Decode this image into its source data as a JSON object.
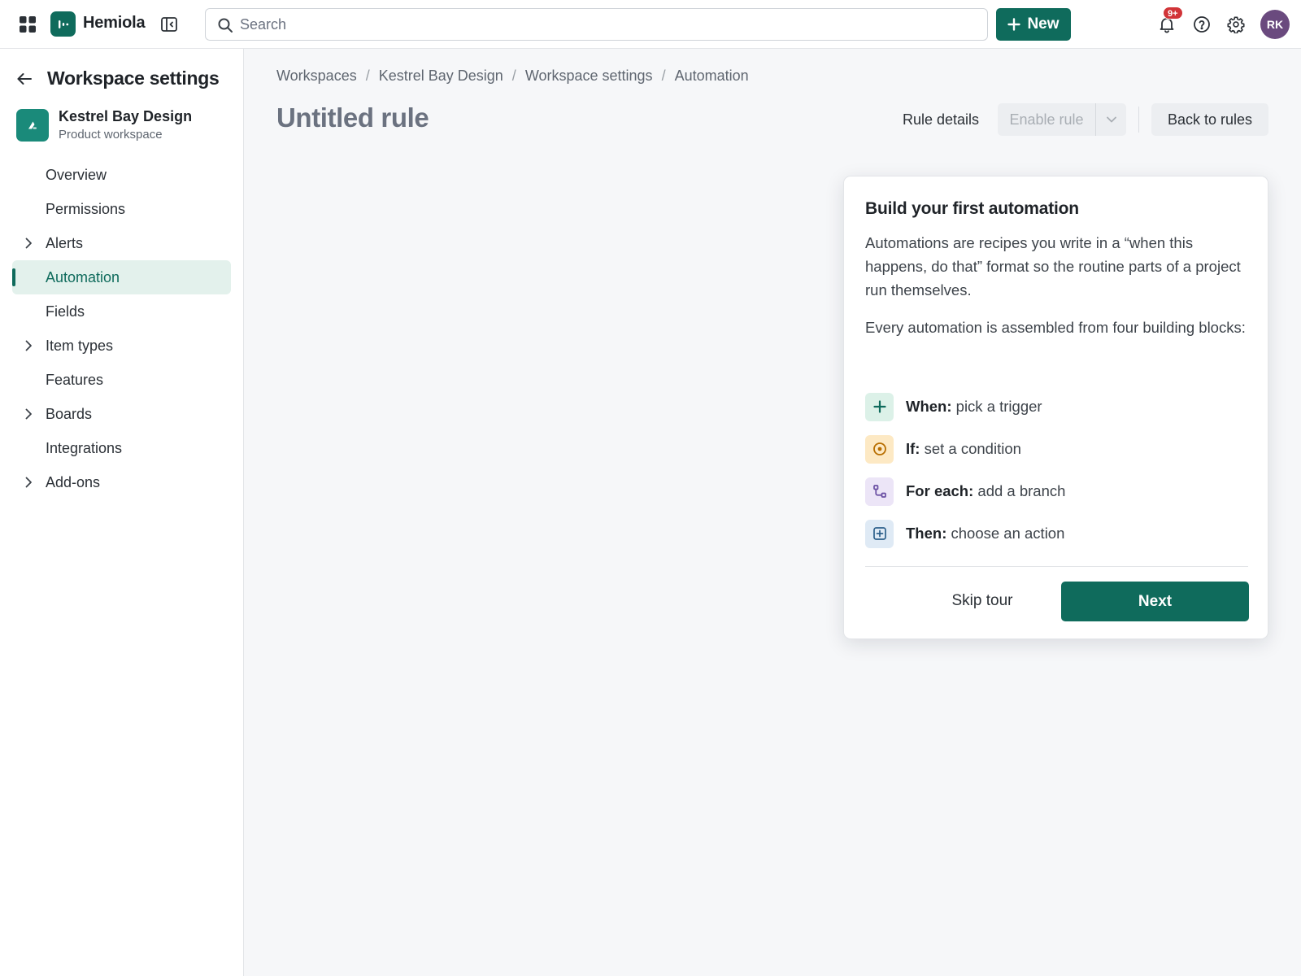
{
  "topbar": {
    "app_name": "Hemiola",
    "search_placeholder": "Search",
    "new_label": "New",
    "notification_badge": "9+",
    "avatar_initials": "RK",
    "brand_color": "#0f6b5c"
  },
  "sidebar": {
    "title": "Workspace settings",
    "workspace_name": "Kestrel Bay Design",
    "workspace_type": "Product workspace",
    "items": [
      {
        "label": "Overview",
        "expandable": false,
        "active": false
      },
      {
        "label": "Permissions",
        "expandable": false,
        "active": false
      },
      {
        "label": "Alerts",
        "expandable": true,
        "active": false
      },
      {
        "label": "Automation",
        "expandable": false,
        "active": true
      },
      {
        "label": "Fields",
        "expandable": false,
        "active": false
      },
      {
        "label": "Item types",
        "expandable": true,
        "active": false
      },
      {
        "label": "Features",
        "expandable": false,
        "active": false
      },
      {
        "label": "Boards",
        "expandable": true,
        "active": false
      },
      {
        "label": "Integrations",
        "expandable": false,
        "active": false
      },
      {
        "label": "Add-ons",
        "expandable": true,
        "active": false
      }
    ]
  },
  "breadcrumb": [
    "Workspaces",
    "Kestrel Bay Design",
    "Workspace settings",
    "Automation"
  ],
  "page": {
    "title": "Untitled rule",
    "rule_details_label": "Rule details",
    "enable_rule_label": "Enable rule",
    "back_to_rules_label": "Back to rules"
  },
  "tour": {
    "title": "Build your first automation",
    "paragraph_1": "Automations are recipes you write in a “when this happens, do that” format so the routine parts of a project run themselves.",
    "paragraph_2": "Every automation is assembled from four building blocks:",
    "steps": [
      {
        "label": "When:",
        "text": "pick a trigger",
        "icon": "plus-icon",
        "color": "#0f6b5c",
        "bg": "#dcf1e8"
      },
      {
        "label": "If:",
        "text": "set a condition",
        "icon": "target-icon",
        "color": "#b86e00",
        "bg": "#fde9c4"
      },
      {
        "label": "For each:",
        "text": "add a branch",
        "icon": "branch-icon",
        "color": "#6a4fa3",
        "bg": "#ece5f7"
      },
      {
        "label": "Then:",
        "text": "choose an action",
        "icon": "action-icon",
        "color": "#2c5f8a",
        "bg": "#dfeaf5"
      }
    ],
    "skip_label": "Skip tour",
    "next_label": "Next"
  }
}
